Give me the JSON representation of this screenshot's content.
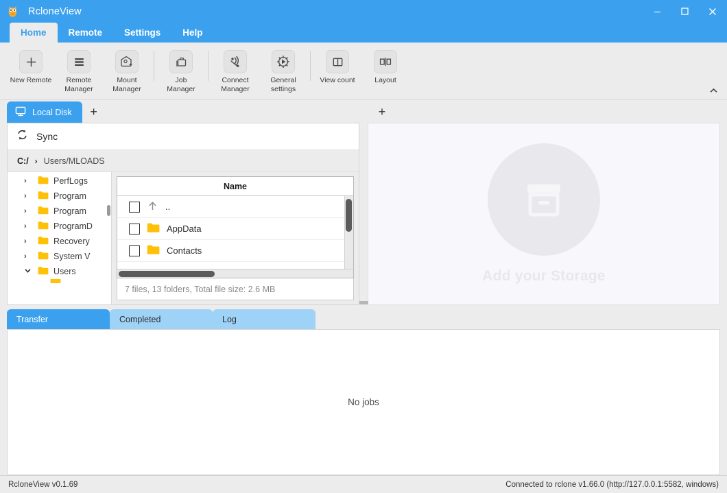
{
  "window": {
    "app_name": "RcloneView",
    "logo_icon": "owl-logo-icon",
    "minimize_label": "–",
    "maximize_label": "☐",
    "close_label": "✕",
    "accent_color": "#3ba1ef",
    "chrome_color": "#ececec"
  },
  "menubar": {
    "items": [
      {
        "label": "Home",
        "active": true
      },
      {
        "label": "Remote",
        "active": false
      },
      {
        "label": "Settings",
        "active": false
      },
      {
        "label": "Help",
        "active": false
      }
    ]
  },
  "toolbar": {
    "collapse_icon": "chevron-up-icon",
    "items": [
      {
        "label": "New Remote",
        "icon": "plus-icon"
      },
      {
        "label": "Remote\nManager",
        "icon": "list-icon"
      },
      {
        "label": "Mount\nManager",
        "icon": "mount-add-icon"
      },
      {
        "label": "Job\nManager",
        "icon": "briefcase-icon"
      },
      {
        "label": "Connect\nManager",
        "icon": "signal-icon"
      },
      {
        "label": "General\nsettings",
        "icon": "gear-icon"
      },
      {
        "label": "View count",
        "icon": "split-view-icon"
      },
      {
        "label": "Layout",
        "icon": "layout-icon"
      }
    ]
  },
  "left_pane": {
    "tab": {
      "label": "Local Disk",
      "icon": "monitor-icon"
    },
    "add_tab_label": "+",
    "sync": {
      "label": "Sync",
      "icon": "sync-icon"
    },
    "breadcrumb": {
      "root": "C:/",
      "separator": "›",
      "path": "Users/MLOADS"
    },
    "tree": {
      "items": [
        {
          "label": "PerfLogs",
          "arrow": "›",
          "expanded": false
        },
        {
          "label": "Program",
          "arrow": "›",
          "expanded": false
        },
        {
          "label": "Program",
          "arrow": "›",
          "expanded": false
        },
        {
          "label": "ProgramD",
          "arrow": "›",
          "expanded": false
        },
        {
          "label": "Recovery",
          "arrow": "›",
          "expanded": false
        },
        {
          "label": "System V",
          "arrow": "›",
          "expanded": false
        },
        {
          "label": "Users",
          "arrow": "⌄",
          "expanded": true
        }
      ]
    },
    "filelist": {
      "column_header": "Name",
      "rows": [
        {
          "name": "..",
          "icon": "arrow-up-icon",
          "checked": false
        },
        {
          "name": "AppData",
          "icon": "folder-icon",
          "checked": false
        },
        {
          "name": "Contacts",
          "icon": "folder-icon",
          "checked": false
        }
      ],
      "status": "7 files, 13 folders, Total file size: 2.6 MB"
    }
  },
  "right_pane": {
    "add_tab_label": "+",
    "empty_state": {
      "text": "Add your Storage",
      "icon": "storage-box-icon"
    }
  },
  "jobs": {
    "tabs": [
      {
        "label": "Transfer",
        "active": true
      },
      {
        "label": "Completed",
        "active": false
      },
      {
        "label": "Log",
        "active": false
      }
    ],
    "empty_text": "No jobs"
  },
  "statusbar": {
    "version": "RcloneView v0.1.69",
    "connection": "Connected to rclone v1.66.0 (http://127.0.0.1:5582, windows)"
  }
}
